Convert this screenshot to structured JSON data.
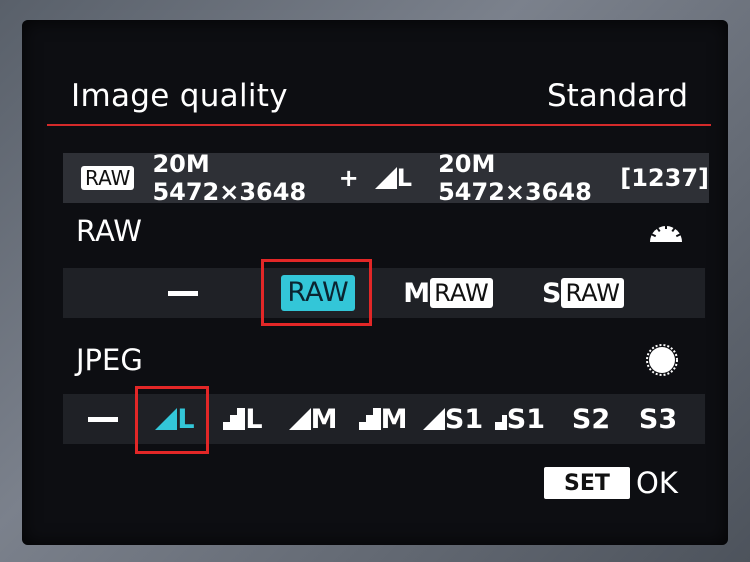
{
  "header": {
    "title": "Image quality",
    "mode": "Standard"
  },
  "summary": {
    "raw_badge": "RAW",
    "raw_size": "20M 5472×3648",
    "plus": "+",
    "jpeg_quality": "L",
    "jpeg_size": "20M 5472×3648",
    "shots_remaining": "[1237]"
  },
  "raw": {
    "label": "RAW",
    "control_icon": "main-dial-icon",
    "options": [
      "—",
      "RAW",
      "M RAW",
      "S RAW"
    ],
    "selected": "RAW",
    "opt_m_prefix": "M",
    "opt_s_prefix": "S",
    "opt_badge": "RAW"
  },
  "jpeg": {
    "label": "JPEG",
    "control_icon": "quick-control-dial-icon",
    "options": [
      "—",
      "L",
      "L",
      "M",
      "M",
      "S1",
      "S1",
      "S2",
      "S3"
    ],
    "selected": "L (fine)"
  },
  "footer": {
    "set_label": "SET",
    "ok_label": "OK"
  },
  "colors": {
    "accent": "#e22727",
    "selected_fill": "#33c6d8"
  }
}
